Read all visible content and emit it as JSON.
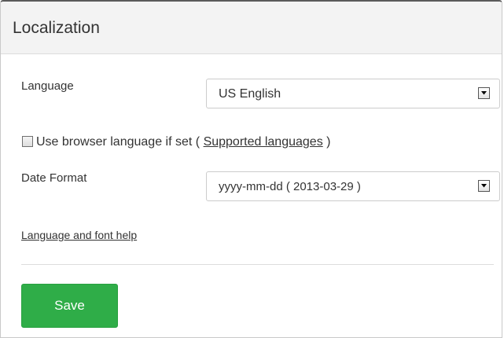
{
  "panel": {
    "title": "Localization"
  },
  "language": {
    "label": "Language",
    "selected": "US English"
  },
  "browser_language": {
    "checked": false,
    "label_prefix": "Use browser language if set (",
    "link_text": "Supported languages",
    "label_suffix": ")"
  },
  "date_format": {
    "label": "Date Format",
    "selected": "yyyy-mm-dd ( 2013-03-29 )"
  },
  "help": {
    "link_text": "Language and font help"
  },
  "actions": {
    "save_label": "Save",
    "save_color": "#2fad48"
  },
  "icons": {
    "dropdown": "chevron-down-icon",
    "checkbox": "checkbox-unchecked"
  }
}
